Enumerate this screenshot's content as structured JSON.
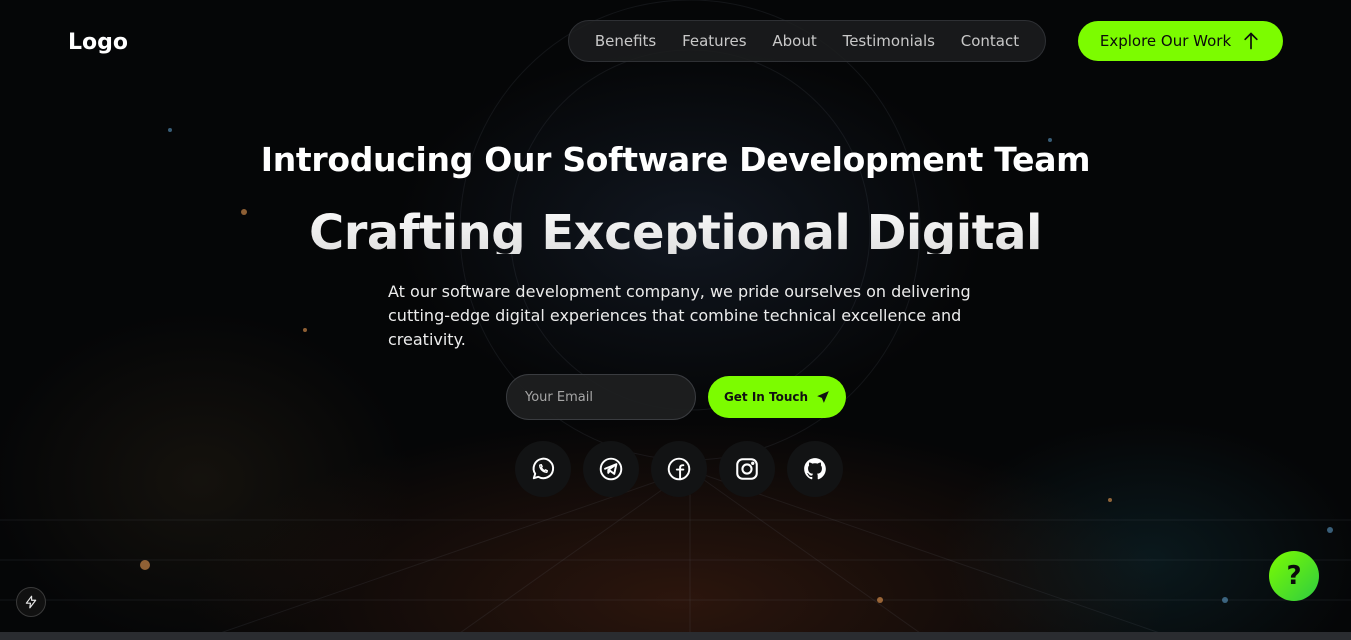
{
  "header": {
    "logo": "Logo",
    "nav": [
      "Benefits",
      "Features",
      "About",
      "Testimonials",
      "Contact"
    ],
    "cta_label": "Explore Our Work"
  },
  "hero": {
    "title": "Introducing Our Software Development Team",
    "headline": "Crafting Exceptional Digital",
    "description": "At our software development company, we pride ourselves on delivering cutting-edge digital experiences that combine technical excellence and creativity."
  },
  "contact": {
    "email_placeholder": "Your Email",
    "button_label": "Get In Touch"
  },
  "socials": [
    "whatsapp-icon",
    "telegram-icon",
    "facebook-icon",
    "instagram-icon",
    "github-icon"
  ],
  "help_label": "?",
  "colors": {
    "accent": "#7cfc00",
    "background": "#050607",
    "nav_bg": "#1c1d1f"
  }
}
